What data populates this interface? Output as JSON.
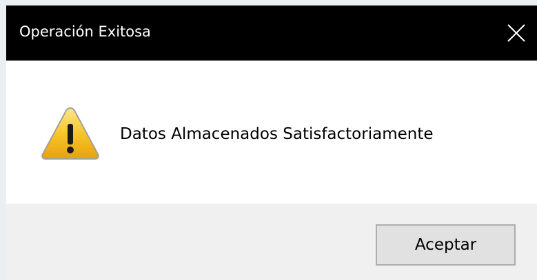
{
  "window": {
    "title": "Operación Exitosa",
    "close_icon": "close-icon"
  },
  "body": {
    "icon": "warning-icon",
    "message": "Datos Almacenados Satisfactoriamente"
  },
  "buttons": {
    "accept_label": "Aceptar"
  },
  "colors": {
    "titlebar": "#000000",
    "title_text": "#ffffff",
    "content_bg": "#ffffff",
    "footer_bg": "#f0f0f0",
    "button_bg": "#e1e1e1",
    "button_border": "#adadad",
    "warning_yellow": "#f5c518"
  }
}
